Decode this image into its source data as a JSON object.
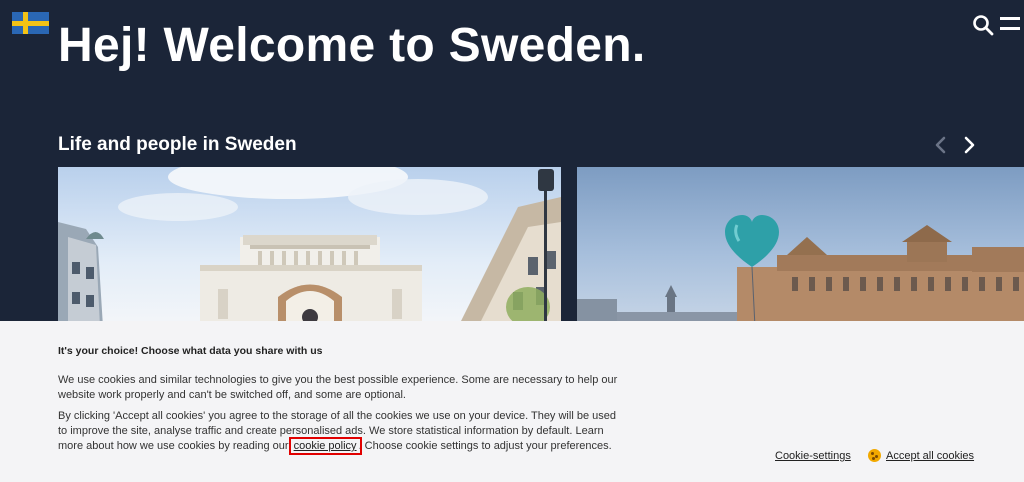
{
  "header": {
    "title": "Hej! Welcome to Sweden.",
    "flag_icon": "sweden-flag-icon",
    "search_icon": "search-icon",
    "menu_icon": "menu-icon"
  },
  "section": {
    "title": "Life and people in Sweden",
    "prev_icon": "chevron-left-icon",
    "next_icon": "chevron-right-icon"
  },
  "cards": [
    {
      "image": "white-synagogue-building-photo"
    },
    {
      "image": "parliament-building-with-heart-balloon-photo"
    }
  ],
  "cookie_banner": {
    "heading": "It's your choice! Choose what data you share with us",
    "paragraph1": "We use cookies and similar technologies to give you the best possible experience. Some are necessary to help our website work properly and can't be switched off, and some are optional.",
    "paragraph2_before": "By clicking 'Accept all cookies' you agree to the storage of all the cookies we use on your device. They will be used to improve the site, analyse traffic and create personalised ads. We store statistical information by default. Learn more about how we use cookies by reading our ",
    "policy_link": "cookie policy",
    "paragraph2_after": ". Choose cookie settings to adjust your preferences.",
    "settings_label": "Cookie-settings",
    "accept_label": "Accept all cookies",
    "accept_icon": "cookie-icon"
  },
  "colors": {
    "background": "#1b2538",
    "banner": "#f4f4f6",
    "flag_blue": "#2a67b4",
    "flag_yellow": "#f3c316",
    "highlight": "#e10000"
  }
}
